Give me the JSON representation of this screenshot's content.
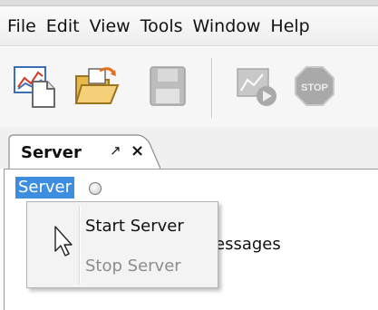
{
  "menubar": {
    "items": [
      {
        "label": "File"
      },
      {
        "label": "Edit"
      },
      {
        "label": "View"
      },
      {
        "label": "Tools"
      },
      {
        "label": "Window"
      },
      {
        "label": "Help"
      }
    ]
  },
  "toolbar": {
    "buttons": [
      {
        "icon": "new-chart-document-icon",
        "enabled": true
      },
      {
        "icon": "open-folder-icon",
        "enabled": true
      },
      {
        "icon": "save-disk-icon",
        "enabled": false
      },
      {
        "icon": "run-chart-icon",
        "enabled": false
      },
      {
        "icon": "stop-sign-icon",
        "label": "STOP",
        "enabled": false
      }
    ]
  },
  "tab": {
    "label": "Server",
    "pin_glyph": "↗",
    "close_glyph": "×"
  },
  "tree": {
    "node_label": "Server"
  },
  "background_text": "essages",
  "context_menu": {
    "items": [
      {
        "label": "Start Server",
        "enabled": true
      },
      {
        "label": "Stop Server",
        "enabled": false
      }
    ]
  },
  "colors": {
    "selection": "#3d8ee0",
    "disabled_text": "#8c8c8c",
    "menu_bg": "#f3f3f3"
  }
}
